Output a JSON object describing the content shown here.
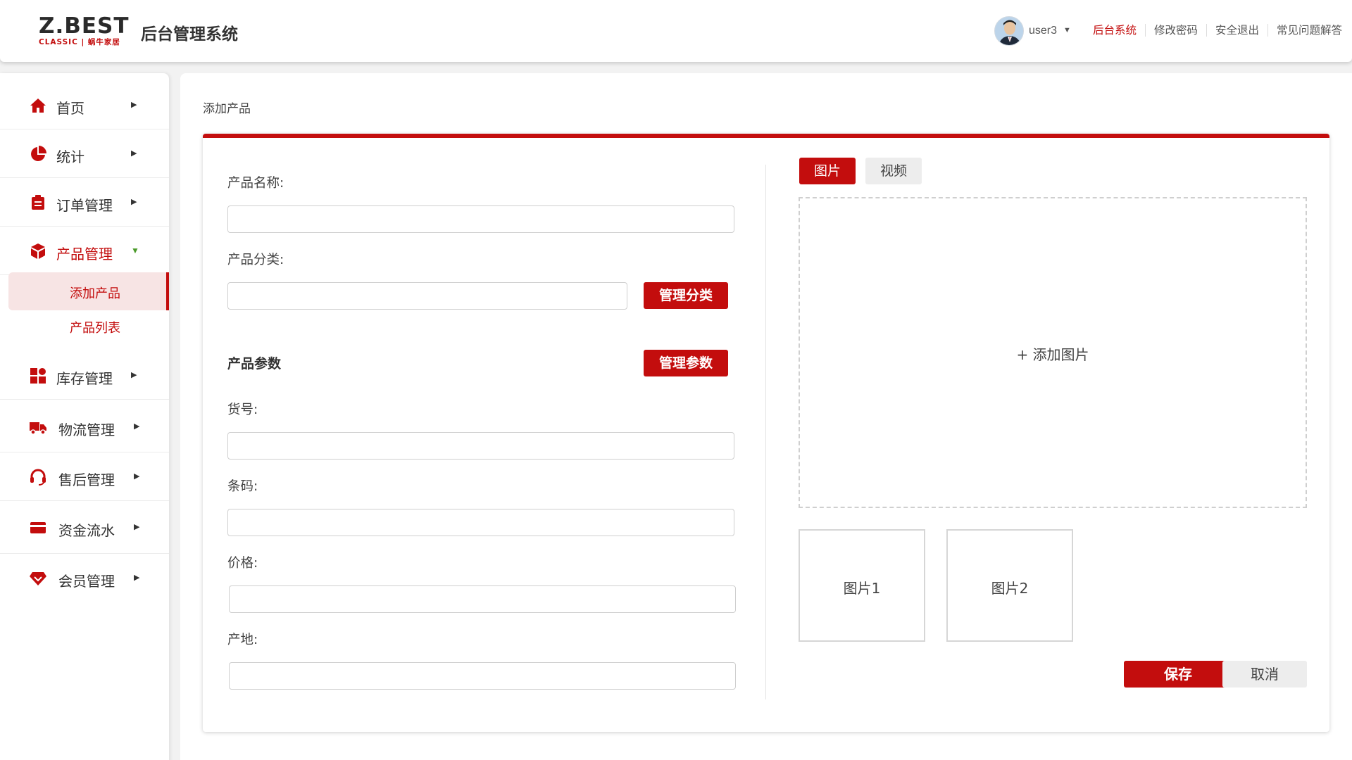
{
  "header": {
    "logo_main": "Z.BEST",
    "logo_sub": "CLASSIC | 蜗牛家居",
    "app_title": "后台管理系统",
    "user_name": "user3",
    "links": [
      "后台系统",
      "修改密码",
      "安全退出",
      "常见问题解答"
    ],
    "active_link_color": "#c30d0d"
  },
  "sidebar": {
    "items": [
      {
        "label": "首页",
        "icon": "home-icon"
      },
      {
        "label": "统计",
        "icon": "pie-chart-icon"
      },
      {
        "label": "订单管理",
        "icon": "clipboard-icon"
      },
      {
        "label": "产品管理",
        "icon": "box-icon",
        "expanded": true
      },
      {
        "label": "库存管理",
        "icon": "grid-icon"
      },
      {
        "label": "物流管理",
        "icon": "truck-icon"
      },
      {
        "label": "售后管理",
        "icon": "headset-icon"
      },
      {
        "label": "资金流水",
        "icon": "card-icon"
      },
      {
        "label": "会员管理",
        "icon": "diamond-heart-icon"
      }
    ],
    "sub_items": [
      {
        "label": "添加产品",
        "selected": true
      },
      {
        "label": "产品列表",
        "selected": false
      }
    ]
  },
  "main": {
    "breadcrumb": "添加产品",
    "form": {
      "name_label": "产品名称:",
      "name_value": "",
      "category_label": "产品分类:",
      "category_value": "",
      "manage_category_button": "管理分类",
      "params_title": "产品参数",
      "manage_params_button": "管理参数",
      "sku_label": "货号:",
      "sku_value": "",
      "barcode_label": "条码:",
      "barcode_value": "",
      "price_label": "价格:",
      "price_value": "",
      "origin_label": "产地:",
      "origin_value": ""
    },
    "media": {
      "tab_image": "图片",
      "tab_video": "视频",
      "active_tab": "图片",
      "add_image": "+ 添加图片",
      "thumbs": [
        "图片1",
        "图片2"
      ]
    },
    "actions": {
      "save": "保存",
      "cancel": "取消"
    }
  },
  "colors": {
    "accent": "#c30d0d",
    "active_sub_bg": "#f7e4e4"
  }
}
